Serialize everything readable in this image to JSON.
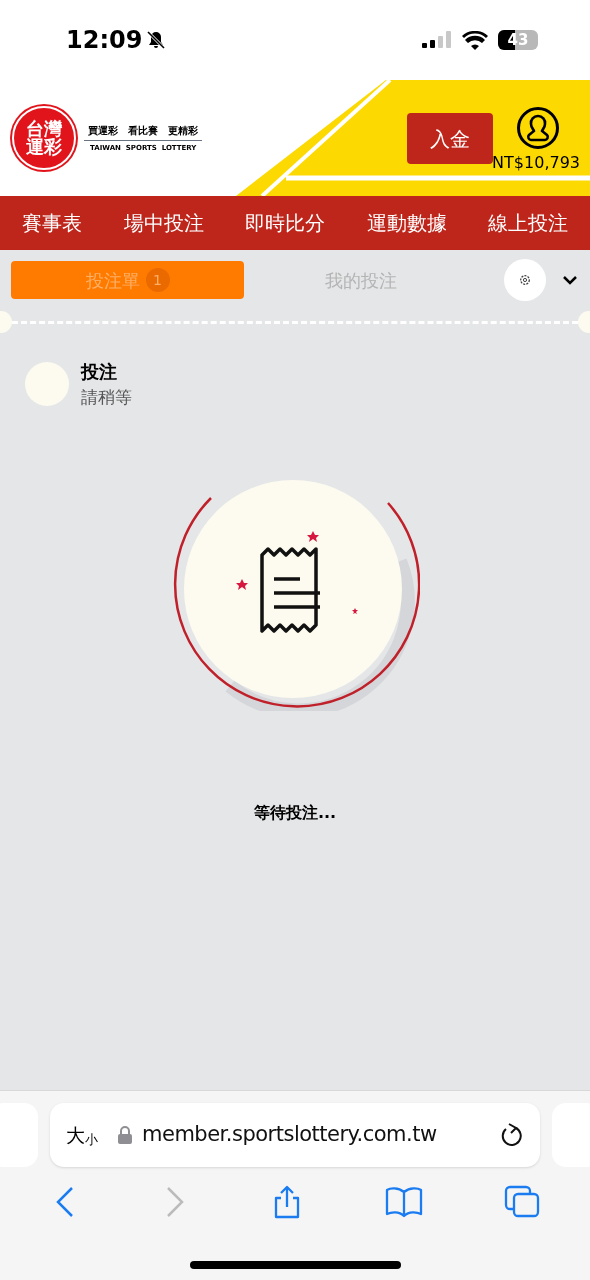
{
  "status_bar": {
    "time": "12:09",
    "battery": "43"
  },
  "header": {
    "logo_top": "台灣",
    "logo_bottom": "運彩",
    "slogan": "買運彩　看比賽　更精彩",
    "slogan_en": "TAIWAN  SPORTS  LOTTERY",
    "deposit_button": "入金",
    "balance": "NT$10,793"
  },
  "nav": [
    {
      "label": "賽事表"
    },
    {
      "label": "場中投注"
    },
    {
      "label": "即時比分"
    },
    {
      "label": "運動數據"
    },
    {
      "label": "線上投注"
    }
  ],
  "tabs": [
    {
      "label": "投注單",
      "badge": "1",
      "selected": true
    },
    {
      "label": "我的投注",
      "selected": false
    }
  ],
  "bet": {
    "title": "投注",
    "subtitle": "請稍等",
    "waiting": "等待投注..."
  },
  "browser": {
    "text_size_big": "大",
    "text_size_small": "小",
    "url": "member.sportslottery.com.tw",
    "back_disabled": false,
    "forward_disabled": true
  }
}
